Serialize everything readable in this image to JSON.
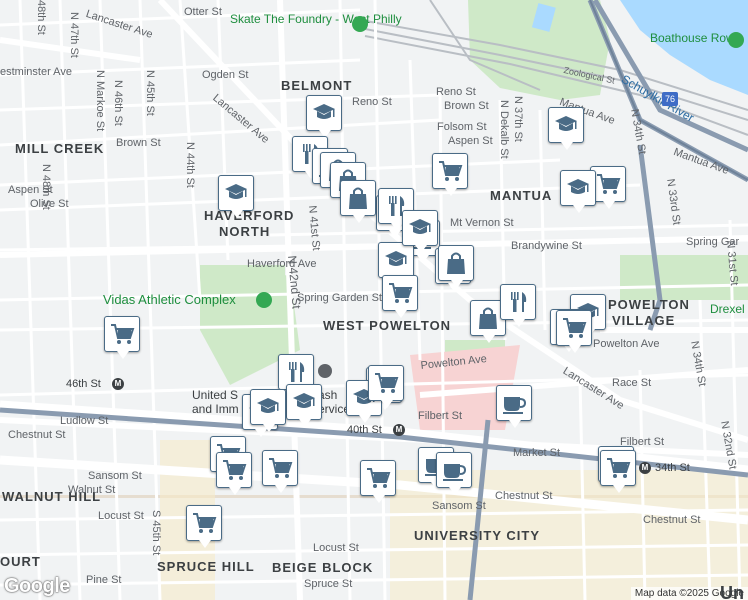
{
  "map": {
    "colors": {
      "land": "#f1f3f4",
      "park": "#cfe9c8",
      "water": "#aadaff",
      "highway": "#8a9bb0",
      "road": "#ffffff",
      "rail": "#b0b4b8",
      "campus": "#f6e7b8",
      "hospital": "#f7d3d3",
      "poi_green": "#1e8e3e",
      "poi_pink": "#d63a6e",
      "pin_icon": "#4a6b86"
    },
    "neighborhoods": [
      {
        "id": "belmont",
        "label": "BELMONT"
      },
      {
        "id": "mill-creek",
        "label": "MILL CREEK"
      },
      {
        "id": "haverford-north-1",
        "label": "HAVERFORD"
      },
      {
        "id": "haverford-north-2",
        "label": "NORTH"
      },
      {
        "id": "mantua",
        "label": "MANTUA"
      },
      {
        "id": "west-powelton",
        "label": "WEST POWELTON"
      },
      {
        "id": "powelton-1",
        "label": "POWELTON"
      },
      {
        "id": "powelton-2",
        "label": "VILLAGE"
      },
      {
        "id": "walnut-hill",
        "label": "WALNUT HILL"
      },
      {
        "id": "university-city",
        "label": "UNIVERSITY CITY"
      },
      {
        "id": "spruce-hill",
        "label": "SPRUCE HILL"
      },
      {
        "id": "beige-block",
        "label": "BEIGE BLOCK"
      },
      {
        "id": "court",
        "label": "OURT"
      }
    ],
    "streets": {
      "otter": "Otter St",
      "lancaster_top": "Lancaster Ave",
      "westminster": "estminster Ave",
      "ogden": "Ogden St",
      "reno": "Reno St",
      "brown_e": "Brown St",
      "brown_w": "Brown St",
      "folsom": "Folsom St",
      "aspen_e": "Aspen St",
      "aspen_w": "Aspen St",
      "olive": "Olive St",
      "mt_vernon": "Mt Vernon St",
      "haverford": "Haverford Ave",
      "brandywine": "Brandywine St",
      "spring_garden_w": "Spring Garden St",
      "spring_garden_e": "Spring Gar",
      "powelton": "Powelton Ave",
      "race": "Race St",
      "filbert_w": "Filbert St",
      "filbert_e": "Filbert St",
      "chestnut_w": "Chestnut St",
      "chestnut_m": "Chestnut St",
      "chestnut_e": "Chestnut St",
      "market": "Market St",
      "sansom_w": "Sansom St",
      "sansom_e": "Sansom St",
      "walnut": "Walnut St",
      "locust_w": "Locust St",
      "locust_e": "Locust St",
      "spruce": "Spruce St",
      "pine": "Pine St",
      "ludlow": "Ludlow St",
      "zoological": "Zoological St",
      "mantua_ave": "Mantua Ave",
      "mantua_ave2": "Mantua Ave",
      "lancaster_w": "Lancaster Ave",
      "lancaster_e": "Lancaster Ave",
      "s_45th": "S 45th St",
      "n48": "N 48th St",
      "n48b": "48th St",
      "n47": "N 47th St",
      "n46": "N 46th St",
      "n45": "N 45th St",
      "n44": "N 44th St",
      "n42": "N 42nd St",
      "n41": "N 41st St",
      "n37": "N 37th St",
      "n36": "N 36th St",
      "dekalb": "N Dekalb St",
      "n34": "N 34th St",
      "n33": "N 33rd St",
      "n32": "N 32nd St",
      "n31": "N 31st St",
      "markoe": "N Markoe St",
      "wyalusing": "N 43rd St",
      "s40": "N 40th St"
    },
    "pois": {
      "skate": "Skate The Foundry - West Philly",
      "boathouse": "Boathouse Row",
      "schuylkill": "Schuylkill River",
      "vidas": "Vidas Athletic Complex",
      "drexel": "Drexel P",
      "united_1": "United S",
      "united_2": "and Imm",
      "services_1": "ash",
      "services_2": "Services"
    },
    "transit": {
      "st46": "46th St",
      "st40": "40th St",
      "st34": "34th St",
      "marker": "M",
      "highway_76": "76"
    },
    "attribution": {
      "text": "Map data ©2025 Google",
      "logo": "Google",
      "partial_label": "Un"
    },
    "markers": [
      {
        "id": "pin-school-1",
        "icon": "school-icon"
      },
      {
        "id": "pin-restaurant-1",
        "icon": "restaurant-icon"
      },
      {
        "id": "pin-cafe-1",
        "icon": "cafe-icon"
      },
      {
        "id": "pin-store-1",
        "icon": "store-icon"
      },
      {
        "id": "pin-store-2",
        "icon": "store-icon"
      },
      {
        "id": "pin-school-2",
        "icon": "school-icon"
      },
      {
        "id": "pin-grocery-1",
        "icon": "grocery-cart-icon"
      },
      {
        "id": "pin-restaurant-2",
        "icon": "restaurant-icon"
      },
      {
        "id": "pin-store-3",
        "icon": "store-icon"
      },
      {
        "id": "pin-cafe-2",
        "icon": "cafe-icon"
      },
      {
        "id": "pin-school-3",
        "icon": "school-icon"
      },
      {
        "id": "pin-grocery-2",
        "icon": "grocery-cart-icon"
      },
      {
        "id": "pin-store-4",
        "icon": "store-icon"
      },
      {
        "id": "pin-store-5",
        "icon": "store-icon"
      },
      {
        "id": "pin-school-4",
        "icon": "school-icon"
      },
      {
        "id": "pin-grocery-3",
        "icon": "grocery-cart-icon"
      },
      {
        "id": "pin-school-5",
        "icon": "school-icon"
      },
      {
        "id": "pin-grocery-4",
        "icon": "grocery-cart-icon"
      },
      {
        "id": "pin-grocery-5",
        "icon": "grocery-cart-icon"
      },
      {
        "id": "pin-restaurant-3",
        "icon": "restaurant-icon"
      },
      {
        "id": "pin-school-6",
        "icon": "school-icon"
      },
      {
        "id": "pin-school-7",
        "icon": "school-icon"
      },
      {
        "id": "pin-restaurant-4",
        "icon": "restaurant-icon"
      },
      {
        "id": "pin-school-8",
        "icon": "school-icon"
      },
      {
        "id": "pin-grocery-6",
        "icon": "grocery-cart-icon"
      },
      {
        "id": "pin-grocery-7",
        "icon": "grocery-cart-icon"
      },
      {
        "id": "pin-grocery-8",
        "icon": "grocery-cart-icon"
      },
      {
        "id": "pin-grocery-9",
        "icon": "grocery-cart-icon"
      },
      {
        "id": "pin-grocery-10",
        "icon": "grocery-cart-icon"
      },
      {
        "id": "pin-cafe-3",
        "icon": "cafe-icon"
      },
      {
        "id": "pin-cafe-4",
        "icon": "cafe-icon"
      },
      {
        "id": "pin-cafe-5",
        "icon": "cafe-icon"
      },
      {
        "id": "pin-store-6",
        "icon": "store-icon"
      },
      {
        "id": "pin-restaurant-5",
        "icon": "restaurant-icon"
      },
      {
        "id": "pin-school-9",
        "icon": "school-icon"
      },
      {
        "id": "pin-cafe-6",
        "icon": "cafe-icon"
      },
      {
        "id": "pin-grocery-11",
        "icon": "grocery-cart-icon"
      },
      {
        "id": "pin-grocery-12",
        "icon": "grocery-cart-icon"
      },
      {
        "id": "pin-school-10",
        "icon": "school-icon"
      },
      {
        "id": "pin-grocery-13",
        "icon": "grocery-cart-icon"
      },
      {
        "id": "pin-school-11",
        "icon": "school-icon"
      },
      {
        "id": "pin-grocery-14",
        "icon": "grocery-cart-icon"
      }
    ]
  }
}
